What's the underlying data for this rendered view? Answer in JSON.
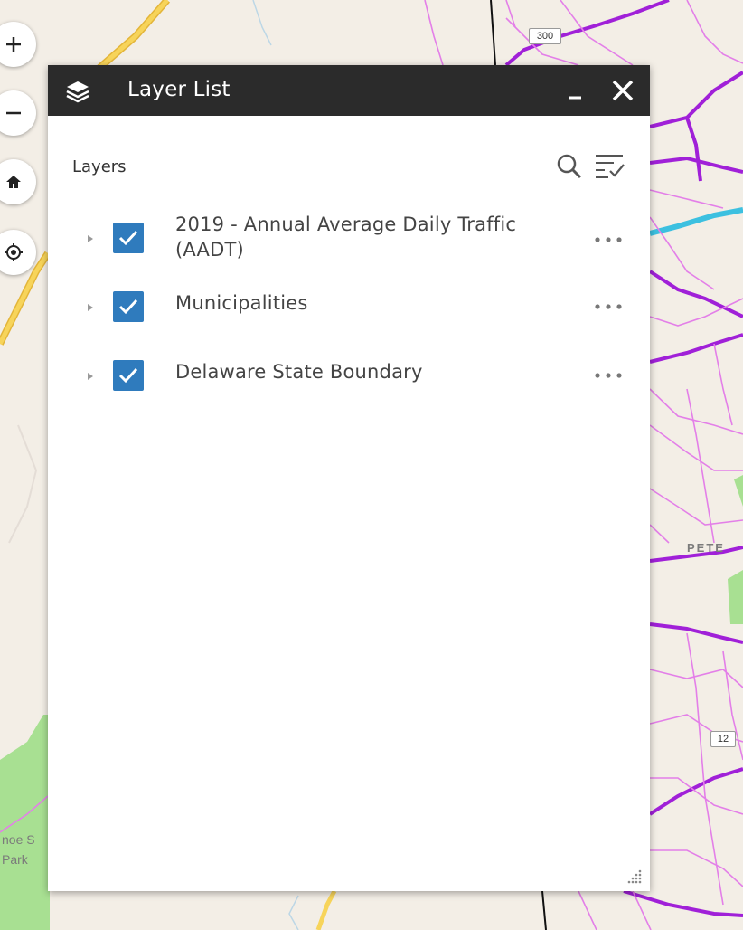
{
  "map": {
    "shields": [
      "300",
      "12"
    ],
    "labels": [
      "PETE",
      "noe S",
      "Park"
    ]
  },
  "map_controls": {
    "zoom_in_icon": "plus-icon",
    "zoom_out_icon": "minus-icon",
    "home_icon": "home-icon",
    "locate_icon": "locate-icon"
  },
  "panel": {
    "title": "Layer List",
    "layers_label": "Layers",
    "layers": [
      {
        "label_line1": "2019 - Annual Average Daily Traffic",
        "label_line2": "(AADT)",
        "checked": true
      },
      {
        "label_line1": "Municipalities",
        "label_line2": "",
        "checked": true
      },
      {
        "label_line1": "Delaware State Boundary",
        "label_line2": "",
        "checked": true
      }
    ]
  },
  "colors": {
    "header_bg": "#2b2b2b",
    "checkbox": "#2f7bbd",
    "major_road": "#a020d8",
    "minor_road": "#e080e8",
    "highway": "#f2c230",
    "river": "#3cc0e0",
    "park": "#9fdd8a"
  }
}
